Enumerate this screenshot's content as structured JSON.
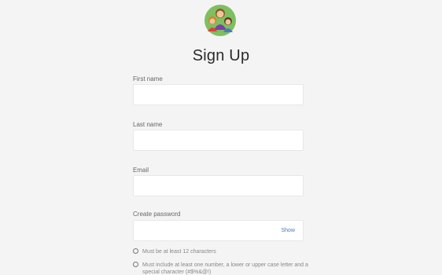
{
  "form": {
    "title": "Sign Up",
    "first_name_label": "First name",
    "last_name_label": "Last name",
    "email_label": "Email",
    "password_label": "Create password",
    "show_label": "Show",
    "requirements": [
      "Must be at least 12 characters",
      "Must include at least one number, a lower or upper case letter and a special character (#$%&@!)"
    ]
  },
  "logo": {
    "icon": "family-avatar-icon"
  },
  "colors": {
    "background": "#f4f4f4",
    "input_background": "#ffffff",
    "link": "#4a78b8"
  }
}
